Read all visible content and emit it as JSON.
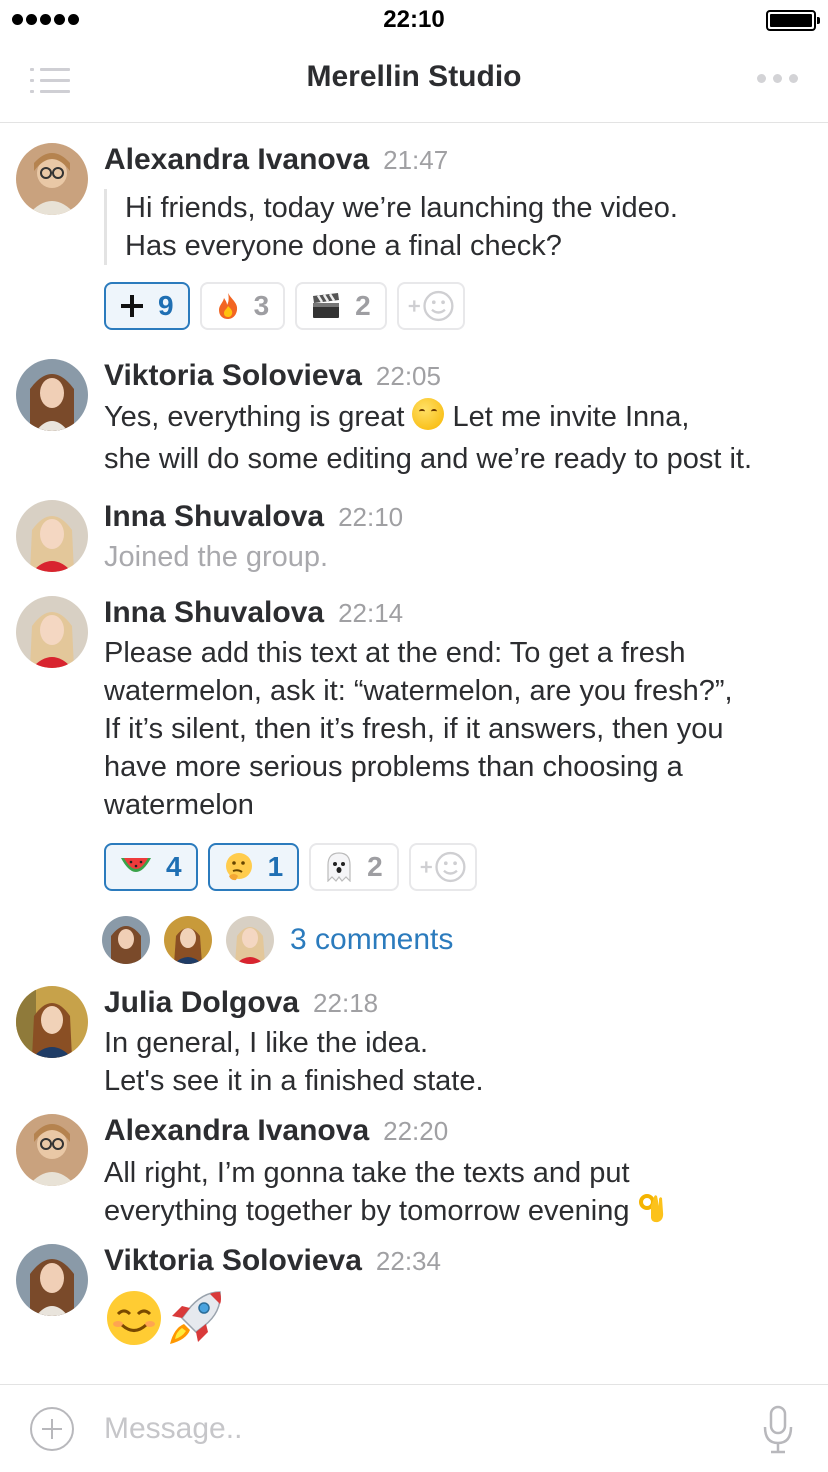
{
  "status_bar": {
    "time": "22:10"
  },
  "header": {
    "title": "Merellin Studio"
  },
  "messages": [
    {
      "author": "Alexandra Ivanova",
      "time": "21:47",
      "lines": [
        "Hi friends, today we’re launching the video.",
        "Has everyone done a final check?"
      ],
      "reactions": [
        {
          "emoji": "plus",
          "count": "9",
          "active": true
        },
        {
          "emoji": "fire",
          "count": "3",
          "active": false
        },
        {
          "emoji": "clapper",
          "count": "2",
          "active": false
        }
      ]
    },
    {
      "author": "Viktoria Solovieva",
      "time": "22:05",
      "lines": [
        "Yes, everything is great",
        " Let me invite Inna,",
        "she will do some editing and we’re ready to post it."
      ]
    },
    {
      "author": "Inna Shuvalova",
      "time": "22:10",
      "lines": [
        "Joined the group."
      ]
    },
    {
      "author": "Inna Shuvalova",
      "time": "22:14",
      "lines": [
        "Please add this text at the end: To get a fresh",
        "watermelon, ask it: “watermelon, are you fresh?”,",
        "If it’s silent, then it’s fresh, if it answers, then you",
        "have more serious problems than choosing a",
        "watermelon"
      ],
      "reactions": [
        {
          "emoji": "watermelon",
          "count": "4",
          "active": true
        },
        {
          "emoji": "thinking",
          "count": "1",
          "active": true
        },
        {
          "emoji": "ghost",
          "count": "2",
          "active": false
        }
      ],
      "comments_label": "3 comments"
    },
    {
      "author": "Julia Dolgova",
      "time": "22:18",
      "lines": [
        "In general, I like the idea.",
        "Let's see it in a finished state."
      ]
    },
    {
      "author": "Alexandra Ivanova",
      "time": "22:20",
      "lines": [
        "All right, I’m gonna take the texts and put",
        "everything together by tomorrow evening"
      ]
    },
    {
      "author": "Viktoria Solovieva",
      "time": "22:34",
      "emojis": [
        "relaxed-smile",
        "rocket"
      ]
    }
  ],
  "composer": {
    "placeholder": "Message.."
  },
  "colors": {
    "accent": "#2b7bbd",
    "text": "#2c2d30",
    "muted": "#a0a0a3"
  }
}
